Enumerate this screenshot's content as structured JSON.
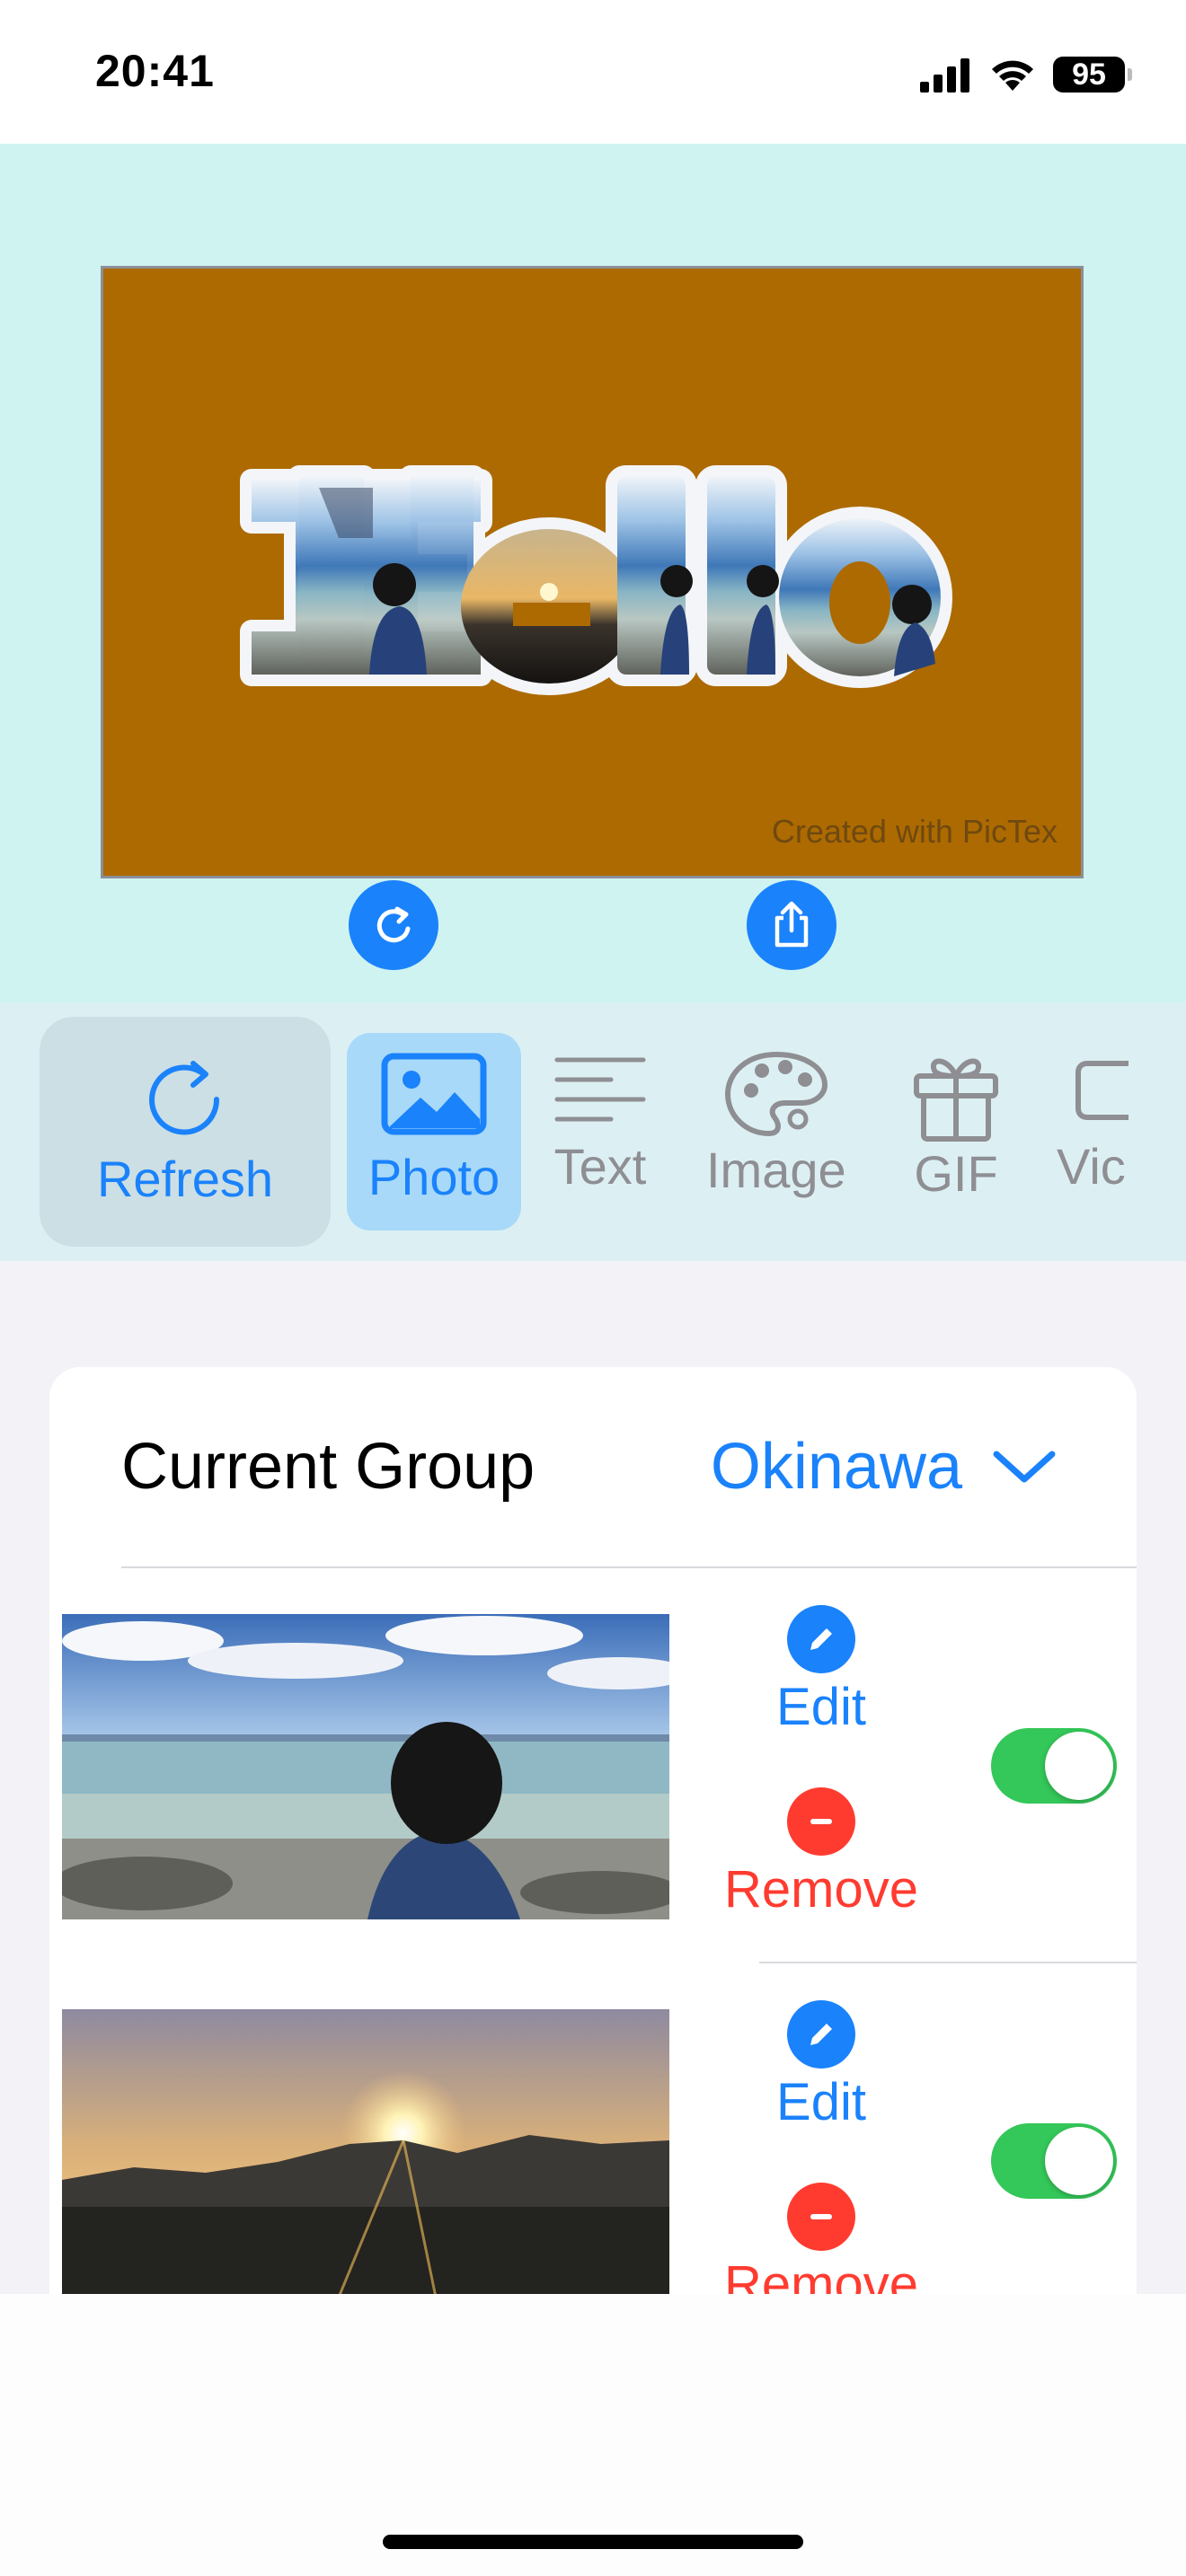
{
  "status_bar": {
    "time": "20:41",
    "battery": "95"
  },
  "preview": {
    "text": "Hello",
    "watermark": "Created with PicTex",
    "background_color": "#ad6a00",
    "area_color": "#cef3f1"
  },
  "toolbar": {
    "items": [
      {
        "label": "Refresh",
        "icon": "refresh-icon",
        "state": "highlighted"
      },
      {
        "label": "Photo",
        "icon": "photo-icon",
        "state": "selected"
      },
      {
        "label": "Text",
        "icon": "text-lines-icon"
      },
      {
        "label": "Image",
        "icon": "palette-icon"
      },
      {
        "label": "GIF",
        "icon": "gift-icon"
      },
      {
        "label": "Vic",
        "icon": "video-icon"
      }
    ]
  },
  "group": {
    "label": "Current Group",
    "value": "Okinawa"
  },
  "photos": [
    {
      "edit_label": "Edit",
      "remove_label": "Remove",
      "enabled": true
    },
    {
      "edit_label": "Edit",
      "remove_label": "Remove",
      "enabled": true
    }
  ],
  "colors": {
    "accent": "#1a82fb",
    "destructive": "#ff3b30",
    "toggle_on": "#34c759"
  }
}
